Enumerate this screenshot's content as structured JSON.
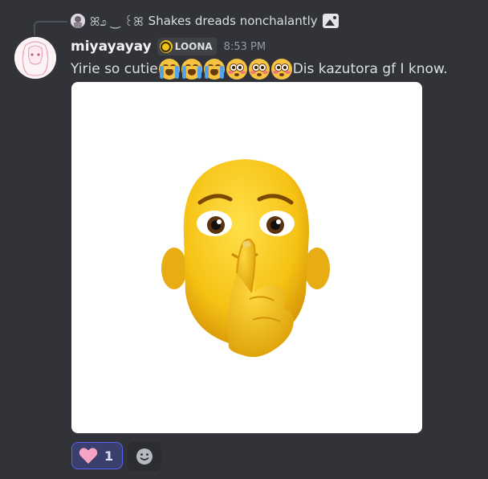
{
  "reply": {
    "name": "ꕤ೨ ‿ ꒰ꕤ",
    "content": "Shakes dreads nonchalantly",
    "attachment_icon": "image-icon"
  },
  "message": {
    "username": "miyayayay",
    "role_tag": "LOONA",
    "timestamp": "8:53 PM",
    "text_before": "Yirie so cutie ",
    "emojis": [
      "loudly-crying-face",
      "loudly-crying-face",
      "loudly-crying-face",
      "flushed-face",
      "flushed-face",
      "flushed-face"
    ],
    "text_after": "Dis kazutora gf I know.",
    "attachment": "shushing-face-image"
  },
  "reactions": [
    {
      "emoji": "pink-heart",
      "count": "1",
      "active": true
    }
  ],
  "add_reaction_icon": "smiley-add-icon",
  "colors": {
    "background": "#313338",
    "username": "#f2f3f5",
    "timestamp": "#949ba4",
    "reaction_active_bg": "#3b3f6e",
    "reaction_active_border": "#5865f2"
  }
}
